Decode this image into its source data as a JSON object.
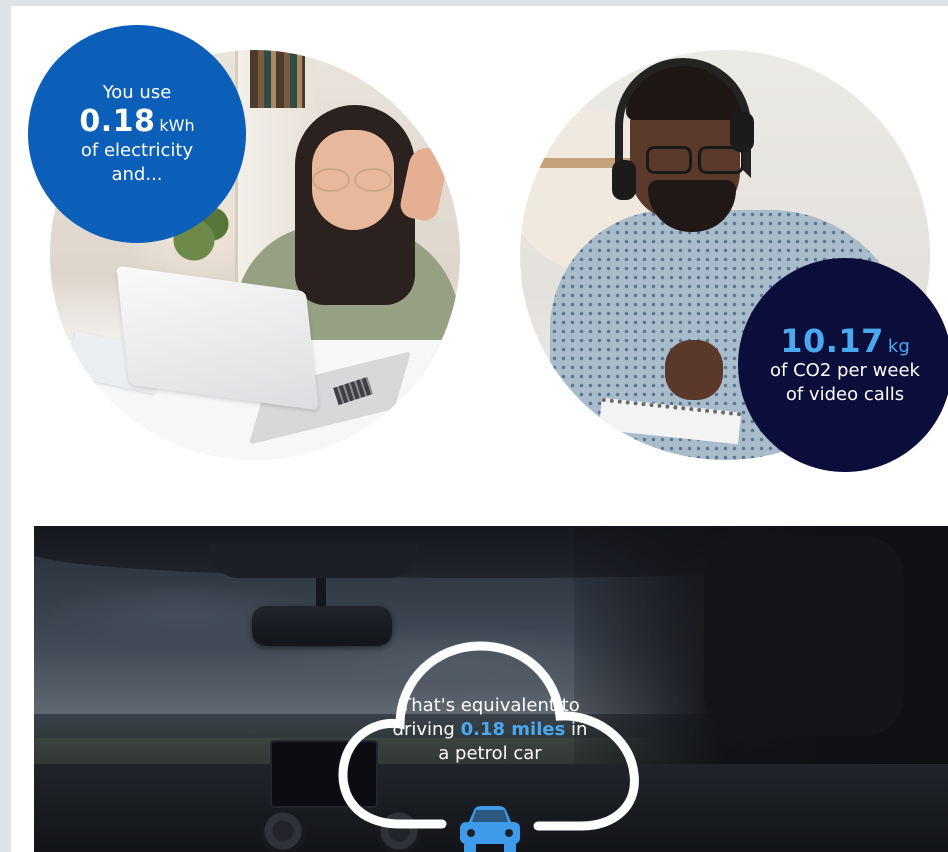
{
  "stat_electricity": {
    "line1": "You use",
    "value": "0.18",
    "unit": "kWh",
    "line2": "of electricity",
    "line3": "and..."
  },
  "stat_co2": {
    "value": "10.17",
    "unit": "kg",
    "line1": "of CO2 per week",
    "line2": "of video calls"
  },
  "equivalent": {
    "line1": "That's equivalent to",
    "prefix": "driving",
    "highlight": "0.18 miles",
    "suffix": "in",
    "line3": "a petrol car"
  },
  "icons": {
    "car": "car-icon",
    "cloud": "cloud-icon"
  },
  "colors": {
    "blue_bubble": "#0b5fb9",
    "navy_bubble": "#0b0e3a",
    "accent": "#4aa8f0",
    "car_icon": "#3d9be9"
  }
}
